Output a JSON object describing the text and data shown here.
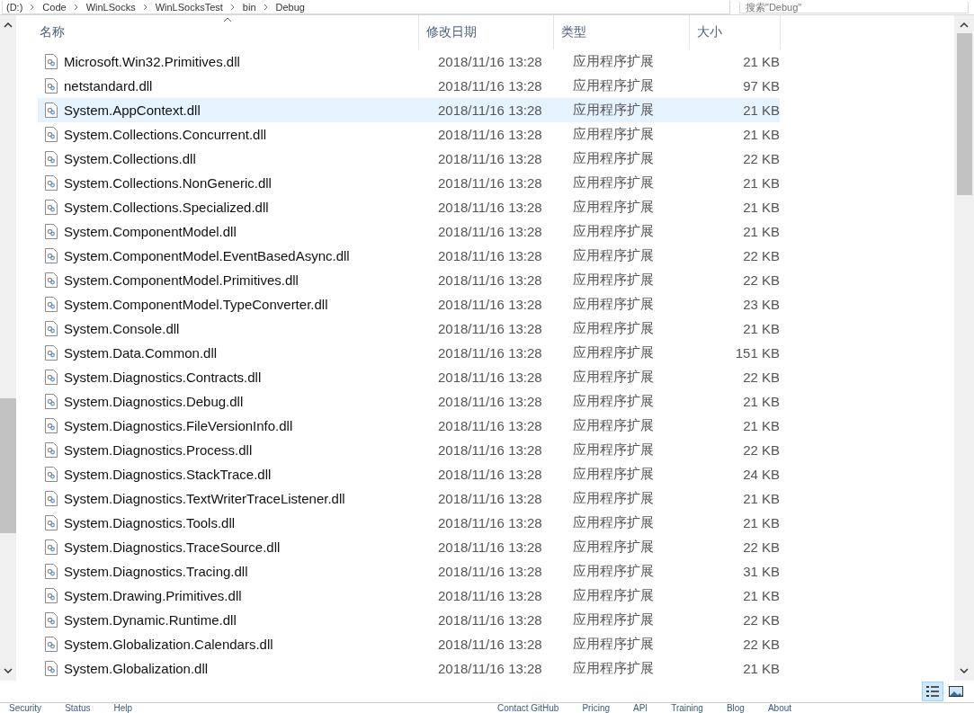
{
  "address_bar": {
    "crumbs": [
      "(D:)",
      "Code",
      "WinLSocks",
      "WinLSocksTest",
      "bin",
      "Debug"
    ]
  },
  "search": {
    "placeholder": "搜索\"Debug\""
  },
  "table": {
    "columns": [
      "名称",
      "修改日期",
      "类型",
      "大小"
    ],
    "rows": [
      {
        "name": "Microsoft.Win32.Primitives.dll",
        "date": "2018/11/16 13:28",
        "type": "应用程序扩展",
        "size": "21 KB",
        "selected": false
      },
      {
        "name": "netstandard.dll",
        "date": "2018/11/16 13:28",
        "type": "应用程序扩展",
        "size": "97 KB",
        "selected": false
      },
      {
        "name": "System.AppContext.dll",
        "date": "2018/11/16 13:28",
        "type": "应用程序扩展",
        "size": "21 KB",
        "selected": true
      },
      {
        "name": "System.Collections.Concurrent.dll",
        "date": "2018/11/16 13:28",
        "type": "应用程序扩展",
        "size": "21 KB",
        "selected": false
      },
      {
        "name": "System.Collections.dll",
        "date": "2018/11/16 13:28",
        "type": "应用程序扩展",
        "size": "22 KB",
        "selected": false
      },
      {
        "name": "System.Collections.NonGeneric.dll",
        "date": "2018/11/16 13:28",
        "type": "应用程序扩展",
        "size": "21 KB",
        "selected": false
      },
      {
        "name": "System.Collections.Specialized.dll",
        "date": "2018/11/16 13:28",
        "type": "应用程序扩展",
        "size": "21 KB",
        "selected": false
      },
      {
        "name": "System.ComponentModel.dll",
        "date": "2018/11/16 13:28",
        "type": "应用程序扩展",
        "size": "21 KB",
        "selected": false
      },
      {
        "name": "System.ComponentModel.EventBasedAsync.dll",
        "date": "2018/11/16 13:28",
        "type": "应用程序扩展",
        "size": "22 KB",
        "selected": false
      },
      {
        "name": "System.ComponentModel.Primitives.dll",
        "date": "2018/11/16 13:28",
        "type": "应用程序扩展",
        "size": "22 KB",
        "selected": false
      },
      {
        "name": "System.ComponentModel.TypeConverter.dll",
        "date": "2018/11/16 13:28",
        "type": "应用程序扩展",
        "size": "23 KB",
        "selected": false
      },
      {
        "name": "System.Console.dll",
        "date": "2018/11/16 13:28",
        "type": "应用程序扩展",
        "size": "21 KB",
        "selected": false
      },
      {
        "name": "System.Data.Common.dll",
        "date": "2018/11/16 13:28",
        "type": "应用程序扩展",
        "size": "151 KB",
        "selected": false
      },
      {
        "name": "System.Diagnostics.Contracts.dll",
        "date": "2018/11/16 13:28",
        "type": "应用程序扩展",
        "size": "22 KB",
        "selected": false
      },
      {
        "name": "System.Diagnostics.Debug.dll",
        "date": "2018/11/16 13:28",
        "type": "应用程序扩展",
        "size": "21 KB",
        "selected": false
      },
      {
        "name": "System.Diagnostics.FileVersionInfo.dll",
        "date": "2018/11/16 13:28",
        "type": "应用程序扩展",
        "size": "21 KB",
        "selected": false
      },
      {
        "name": "System.Diagnostics.Process.dll",
        "date": "2018/11/16 13:28",
        "type": "应用程序扩展",
        "size": "22 KB",
        "selected": false
      },
      {
        "name": "System.Diagnostics.StackTrace.dll",
        "date": "2018/11/16 13:28",
        "type": "应用程序扩展",
        "size": "24 KB",
        "selected": false
      },
      {
        "name": "System.Diagnostics.TextWriterTraceListener.dll",
        "date": "2018/11/16 13:28",
        "type": "应用程序扩展",
        "size": "21 KB",
        "selected": false
      },
      {
        "name": "System.Diagnostics.Tools.dll",
        "date": "2018/11/16 13:28",
        "type": "应用程序扩展",
        "size": "21 KB",
        "selected": false
      },
      {
        "name": "System.Diagnostics.TraceSource.dll",
        "date": "2018/11/16 13:28",
        "type": "应用程序扩展",
        "size": "22 KB",
        "selected": false
      },
      {
        "name": "System.Diagnostics.Tracing.dll",
        "date": "2018/11/16 13:28",
        "type": "应用程序扩展",
        "size": "31 KB",
        "selected": false
      },
      {
        "name": "System.Drawing.Primitives.dll",
        "date": "2018/11/16 13:28",
        "type": "应用程序扩展",
        "size": "21 KB",
        "selected": false
      },
      {
        "name": "System.Dynamic.Runtime.dll",
        "date": "2018/11/16 13:28",
        "type": "应用程序扩展",
        "size": "22 KB",
        "selected": false
      },
      {
        "name": "System.Globalization.Calendars.dll",
        "date": "2018/11/16 13:28",
        "type": "应用程序扩展",
        "size": "22 KB",
        "selected": false
      },
      {
        "name": "System.Globalization.dll",
        "date": "2018/11/16 13:28",
        "type": "应用程序扩展",
        "size": "21 KB",
        "selected": false
      }
    ]
  },
  "view_buttons": [
    {
      "kind": "details",
      "selected": true
    },
    {
      "kind": "thumbnails",
      "selected": false
    }
  ],
  "footer_links": [
    "Security",
    "Status",
    "Help",
    "Contact GitHub",
    "Pricing",
    "API",
    "Training",
    "Blog",
    "About"
  ]
}
